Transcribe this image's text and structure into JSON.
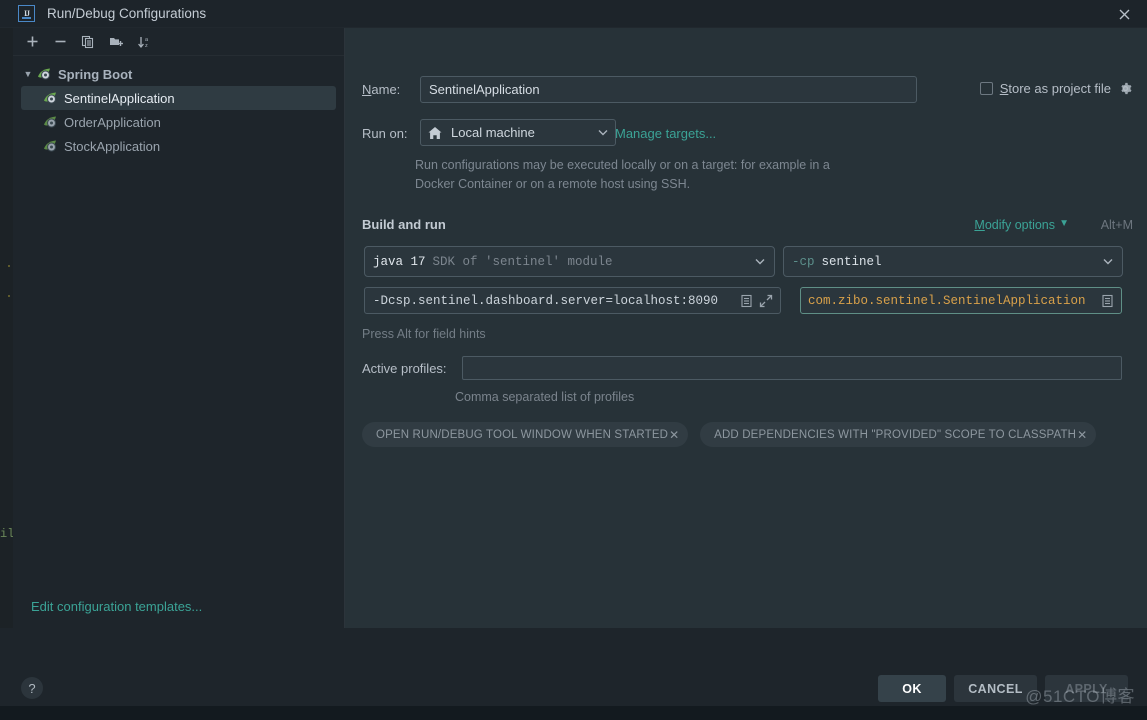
{
  "window": {
    "title": "Run/Debug Configurations",
    "logo_icon": "intellij-idea-logo",
    "close_icon": "close-icon"
  },
  "toolbar": {
    "add_icon": "plus-icon",
    "remove_icon": "minus-icon",
    "copy_icon": "copy-icon",
    "folder_icon": "new-folder-icon",
    "sort_icon": "sort-alphabetically-icon"
  },
  "sidebar": {
    "group": {
      "label": "Spring Boot",
      "expanded": true,
      "chevron_icon": "chevron-down-icon",
      "icon": "spring-boot-icon"
    },
    "items": [
      {
        "label": "SentinelApplication",
        "icon": "spring-boot-icon",
        "selected": true
      },
      {
        "label": "OrderApplication",
        "icon": "spring-boot-icon",
        "selected": false
      },
      {
        "label": "StockApplication",
        "icon": "spring-boot-icon",
        "selected": false
      }
    ],
    "footer_link": "Edit configuration templates..."
  },
  "form": {
    "name_label": "Name:",
    "name_value": "SentinelApplication",
    "store_as_project_file": {
      "label": "Store as project file",
      "checked": false,
      "gear_icon": "gear-icon"
    },
    "run_on_label": "Run on:",
    "run_on_value": "Local machine",
    "run_on_icon": "home-icon",
    "manage_targets_link": "Manage targets...",
    "run_on_hint": "Run configurations may be executed locally or on a target: for example in a Docker Container or on a remote host using SSH."
  },
  "build_and_run": {
    "section_title": "Build and run",
    "modify_options_link": "Modify options",
    "modify_options_caret": "chevron-down-icon",
    "modify_options_shortcut": "Alt+M",
    "jdk": {
      "main": "java 17",
      "sub": "SDK of 'sentinel' module"
    },
    "classpath": {
      "flag": "-cp",
      "value": "sentinel"
    },
    "vm_options": {
      "value": "-Dcsp.sentinel.dashboard.server=localhost:8090",
      "list_icon": "list-icon",
      "expand_icon": "expand-icon"
    },
    "main_class": {
      "value": "com.zibo.sentinel.SentinelApplication",
      "browse_icon": "list-icon"
    },
    "field_hint": "Press Alt for field hints"
  },
  "profiles": {
    "label": "Active profiles:",
    "value": "",
    "placeholder": "",
    "hint": "Comma separated list of profiles"
  },
  "chips": [
    {
      "label": "OPEN RUN/DEBUG TOOL WINDOW WHEN STARTED",
      "close_icon": "close-icon"
    },
    {
      "label": "ADD DEPENDENCIES WITH \"PROVIDED\" SCOPE TO CLASSPATH",
      "close_icon": "close-icon"
    }
  ],
  "footer": {
    "help_label": "?",
    "ok_label": "OK",
    "cancel_label": "CANCEL",
    "apply_label": "APPLY",
    "apply_disabled": true
  },
  "watermark": "@51CTO博客",
  "colors": {
    "accent_link": "#3ba396",
    "dialog_bg": "#273238",
    "panel_bg": "#1e252b",
    "main_class_text": "#d9a14a",
    "selection_bg": "#2f3b42",
    "focus_border": "#5f8f86"
  }
}
